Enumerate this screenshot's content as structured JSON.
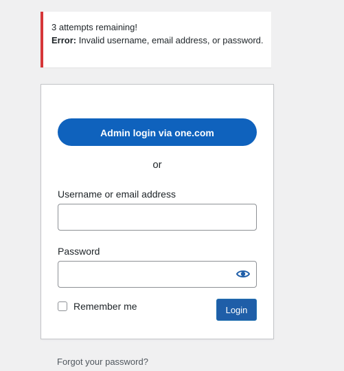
{
  "notice": {
    "attempts": "3 attempts remaining!",
    "error_label": "Error:",
    "error_message": " Invalid username, email address, or password.",
    "accent_color": "#d63638"
  },
  "form": {
    "sso_button_label": "Admin login via one.com",
    "or_text": "or",
    "username_label": "Username or email address",
    "username_value": "",
    "password_label": "Password",
    "password_value": "",
    "password_toggle_icon": "eye-icon",
    "remember_label": "Remember me",
    "remember_checked": false,
    "login_button_label": "Login",
    "brand_color": "#0f62bd"
  },
  "links": {
    "forgot_password": "Forgot your password?"
  }
}
